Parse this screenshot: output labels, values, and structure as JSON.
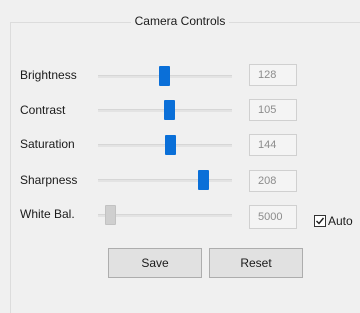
{
  "group": {
    "title": "Camera Controls"
  },
  "controls": [
    {
      "label": "Brightness",
      "value": "128",
      "slider_fraction": 0.49
    },
    {
      "label": "Contrast",
      "value": "105",
      "slider_fraction": 0.53
    },
    {
      "label": "Saturation",
      "value": "144",
      "slider_fraction": 0.54
    },
    {
      "label": "Sharpness",
      "value": "208",
      "slider_fraction": 0.78
    },
    {
      "label": "White Bal.",
      "value": "5000",
      "slider_fraction": 0.09,
      "disabled": true
    }
  ],
  "auto_checkbox": {
    "label": "Auto",
    "checked": true
  },
  "buttons": {
    "save": "Save",
    "reset": "Reset"
  },
  "colors": {
    "thumb": "#0a6fd8",
    "thumb_disabled": "#cfcfcf",
    "value_text": "#8c8c8c"
  }
}
